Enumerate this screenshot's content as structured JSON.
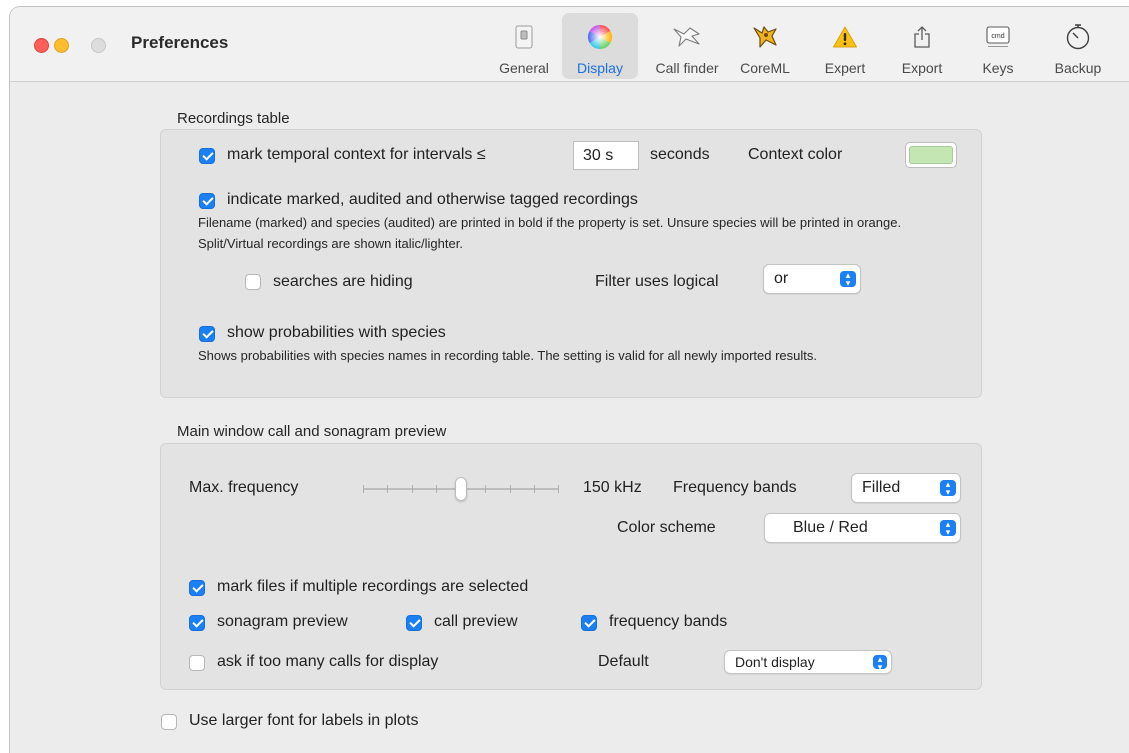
{
  "window": {
    "title": "Preferences"
  },
  "toolbar": {
    "items": [
      {
        "label": "General",
        "icon": "switch-icon"
      },
      {
        "label": "Display",
        "icon": "color-wheel-icon",
        "selected": true
      },
      {
        "label": "Call finder",
        "icon": "bat-icon"
      },
      {
        "label": "CoreML",
        "icon": "coreml-bat-icon"
      },
      {
        "label": "Expert",
        "icon": "warning-icon"
      },
      {
        "label": "Export",
        "icon": "share-icon"
      },
      {
        "label": "Keys",
        "icon": "cmd-key-icon"
      },
      {
        "label": "Backup",
        "icon": "timer-icon"
      }
    ]
  },
  "recordings_table": {
    "title": "Recordings table",
    "temporal_context": {
      "label": "mark temporal context for intervals ≤",
      "value": "30 s",
      "unit": "seconds",
      "checked": true
    },
    "context_color": {
      "label": "Context color",
      "color": "#c3e6b3"
    },
    "indicate_marked": {
      "label": "indicate marked, audited and otherwise tagged recordings",
      "checked": true,
      "description": "Filename (marked) and species (audited) are printed in bold if the property is set. Unsure species will be printed in orange. Split/Virtual recordings are shown italic/lighter."
    },
    "searches_hiding": {
      "label": "searches are hiding",
      "checked": false
    },
    "filter_logical": {
      "label": "Filter uses logical",
      "value": "or"
    },
    "show_probabilities": {
      "label": "show probabilities with species",
      "checked": true,
      "description": "Shows probabilities with species names in recording table. The setting is valid for all newly imported results."
    }
  },
  "preview": {
    "title": "Main window call and sonagram preview",
    "max_frequency": {
      "label": "Max. frequency",
      "value": "150 kHz",
      "slider_fraction": 0.5
    },
    "frequency_bands": {
      "label": "Frequency bands",
      "value": "Filled"
    },
    "color_scheme": {
      "label": "Color scheme",
      "value": "Blue / Red"
    },
    "mark_files": {
      "label": "mark files if multiple recordings are selected",
      "checked": true
    },
    "sonagram_preview": {
      "label": "sonagram preview",
      "checked": true
    },
    "call_preview": {
      "label": "call preview",
      "checked": true
    },
    "frequency_bands_check": {
      "label": "frequency bands",
      "checked": true
    },
    "ask_too_many": {
      "label": "ask if too many calls for display",
      "checked": false
    },
    "default": {
      "label": "Default",
      "value": "Don't display"
    }
  },
  "larger_font": {
    "label": "Use larger font for labels in plots",
    "checked": false
  }
}
